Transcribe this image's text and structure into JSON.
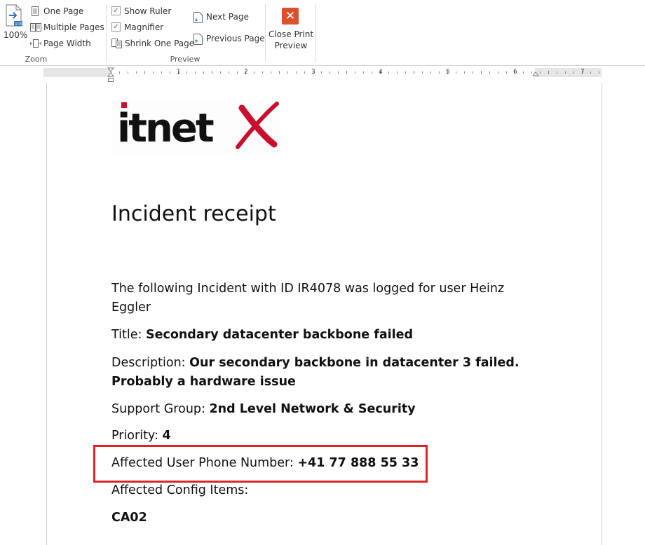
{
  "ribbon": {
    "zoom_group": {
      "label": "Zoom",
      "zoom_percent": "100%",
      "one_page": "One Page",
      "multiple_pages": "Multiple Pages",
      "page_width": "Page Width"
    },
    "preview_group": {
      "label": "Preview",
      "show_ruler": "Show Ruler",
      "show_ruler_checked": true,
      "magnifier": "Magnifier",
      "magnifier_checked": true,
      "shrink_one_page": "Shrink One Page",
      "next_page": "Next Page",
      "previous_page": "Previous Page",
      "close_print_preview_line1": "Close Print",
      "close_print_preview_line2": "Preview"
    }
  },
  "ruler": {
    "numbers": [
      "1",
      "2",
      "3",
      "4",
      "5",
      "6",
      "7"
    ]
  },
  "document": {
    "logo_text": "itnetX",
    "title": "Incident receipt",
    "intro_line1": "The following Incident with ID IR4078 was logged for user Heinz",
    "intro_line2": "Eggler",
    "title_label": "Title: ",
    "title_value": "Secondary datacenter backbone failed",
    "description_label": "Description: ",
    "description_value_line1": "Our secondary backbone in datacenter 3 failed.",
    "description_value_line2": "Probably a hardware issue",
    "support_group_label": "Support Group: ",
    "support_group_value": "2nd Level Network & Security",
    "priority_label": "Priority: ",
    "priority_value": "4",
    "phone_label": "Affected User Phone Number: ",
    "phone_value": "+41 77 888 55 33",
    "config_items_label": "Affected Config Items:",
    "config_items_value": "CA02"
  },
  "colors": {
    "highlight_border": "#d9262b",
    "logo_red": "#c8102e",
    "close_button": "#d9522c"
  }
}
